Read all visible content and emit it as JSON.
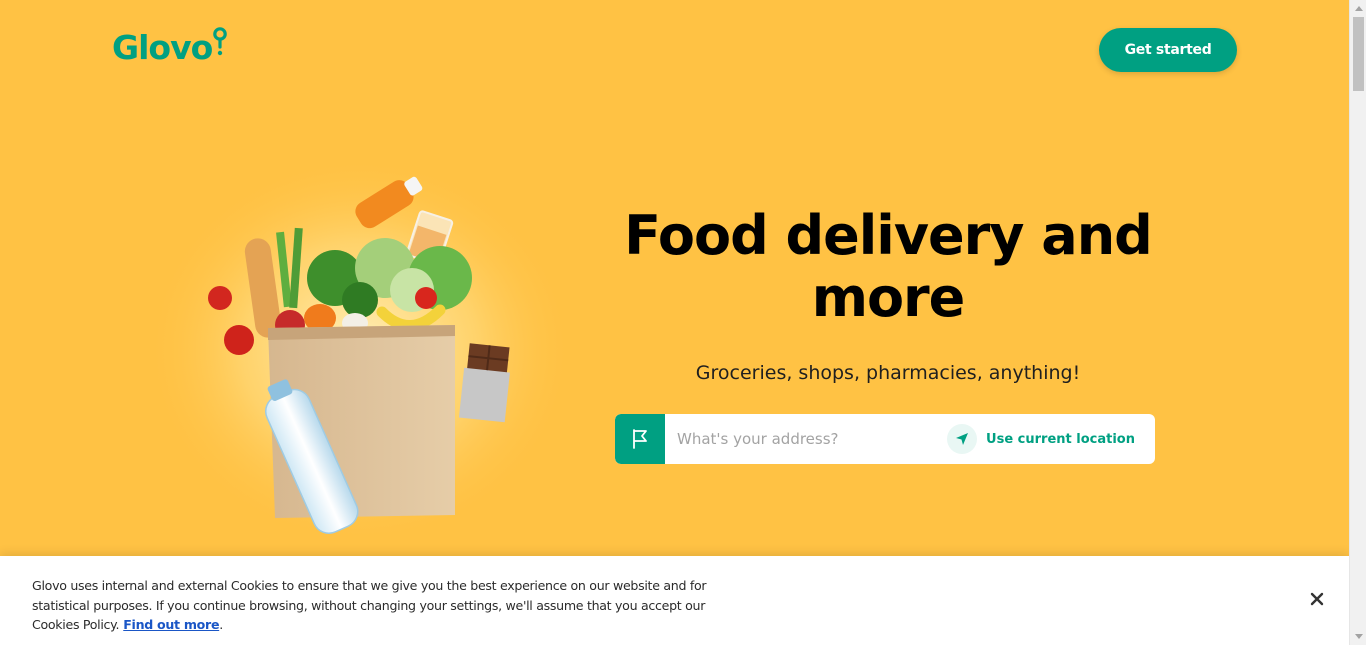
{
  "brand": {
    "name": "Glovo",
    "accent": "#00a082",
    "background": "#ffc244"
  },
  "header": {
    "cta_label": "Get started"
  },
  "hero": {
    "headline": "Food delivery and more",
    "subline": "Groceries, shops, pharmacies, anything!",
    "address": {
      "placeholder": "What's your address?",
      "flag_icon": "flag-icon",
      "use_location_label": "Use current location",
      "location_icon": "navigation-arrow-icon"
    }
  },
  "cookie_banner": {
    "text": "Glovo uses internal and external Cookies to ensure that we give you the best experience on our website and for statistical purposes. If you continue browsing, without changing your settings, we'll assume that you accept our Cookies Policy.",
    "link_label": "Find out more",
    "trailing": ".",
    "close_icon": "close-icon"
  }
}
